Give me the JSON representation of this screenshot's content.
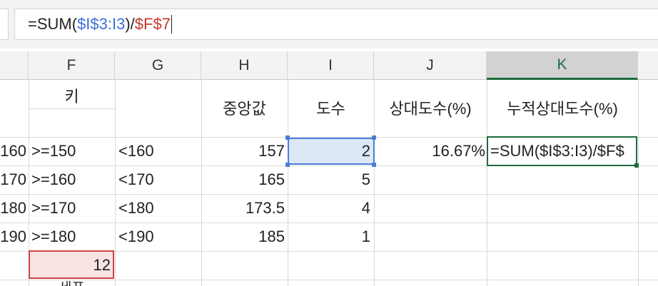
{
  "formula_bar": {
    "tokens": [
      {
        "text": "=SUM(",
        "color": "plain"
      },
      {
        "text": "$I$3:I3",
        "color": "blue"
      },
      {
        "text": ")/",
        "color": "plain"
      },
      {
        "text": "$F$7",
        "color": "red"
      }
    ]
  },
  "columns": [
    "F",
    "G",
    "H",
    "I",
    "J",
    "K"
  ],
  "selected_column": "K",
  "headers": {
    "F": "키",
    "H": "중앙값",
    "I": "도수",
    "J": "상대도수(%)",
    "K": "누적상대도수(%)"
  },
  "rows": [
    {
      "e": "160",
      "f": ">=150",
      "g": "<160",
      "h": "157",
      "i": "2",
      "j": "16.67%",
      "k": "=SUM($I$3:I3)/$F$"
    },
    {
      "e": "170",
      "f": ">=160",
      "g": "<170",
      "h": "165",
      "i": "5",
      "j": "",
      "k": ""
    },
    {
      "e": "180",
      "f": ">=170",
      "g": "<180",
      "h": "173.5",
      "i": "4",
      "j": "",
      "k": ""
    },
    {
      "e": "190",
      "f": ">=180",
      "g": "<190",
      "h": "185",
      "i": "1",
      "j": "",
      "k": ""
    }
  ],
  "total_cell": "12",
  "cut_off_label": "세프",
  "colors": {
    "blue_ref": "#3a6fd8",
    "red_ref": "#c0392b",
    "active_border": "#1e6b3c",
    "selection_blue": "#4a7ed6",
    "selection_red": "#cc4444"
  }
}
